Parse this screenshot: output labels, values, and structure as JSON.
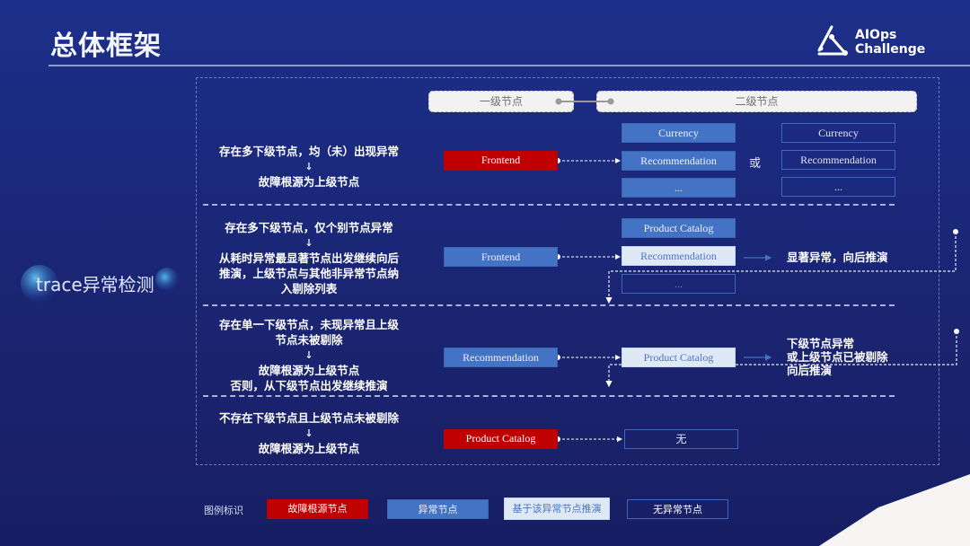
{
  "header": {
    "title": "总体框架",
    "logo": {
      "line1": "AIOps",
      "line2": "Challenge"
    }
  },
  "side_label": "trace异常检测",
  "column_headers": {
    "level1": "一级节点",
    "level2": "二级节点"
  },
  "rows": [
    {
      "condition_lines": [
        "存在多下级节点，均（未）出现异常"
      ],
      "arrow": "↓",
      "result_lines": [
        "故障根源为上级节点"
      ],
      "parent": "Frontend",
      "children_a": [
        "Currency",
        "Recommendation",
        "..."
      ],
      "or_label": "或",
      "children_b": [
        "Currency",
        "Recommendation",
        "..."
      ]
    },
    {
      "condition_lines": [
        "存在多下级节点，仅个别节点异常"
      ],
      "arrow": "↓",
      "result_lines": [
        "从耗时异常最显著节点出发继续向后",
        "推演，上级节点与其他非异常节点纳",
        "入剔除列表"
      ],
      "parent": "Frontend",
      "children": [
        "Product Catalog",
        "Recommendation",
        "..."
      ],
      "note": "显著异常，向后推演"
    },
    {
      "condition_lines": [
        "存在单一下级节点，未现异常且上级",
        "节点未被剔除"
      ],
      "arrow": "↓",
      "result_lines": [
        "故障根源为上级节点",
        "否则，从下级节点出发继续推演"
      ],
      "parent": "Recommendation",
      "child": "Product Catalog",
      "note_lines": [
        "下级节点异常",
        "或上级节点已被剔除",
        "向后推演"
      ]
    },
    {
      "condition_lines": [
        "不存在下级节点且上级节点未被剔除"
      ],
      "arrow": "↓",
      "result_lines": [
        "故障根源为上级节点"
      ],
      "parent": "Product Catalog",
      "child": "无"
    }
  ],
  "legend": {
    "label": "图例标识",
    "items": [
      {
        "label": "故障根源节点",
        "color": "#c00000"
      },
      {
        "label": "异常节点",
        "color": "#4472c4"
      },
      {
        "label": "基于该异常节点推演",
        "color": "#dfe9f6"
      },
      {
        "label": "无异常节点",
        "color": "#3d65c2"
      }
    ]
  }
}
